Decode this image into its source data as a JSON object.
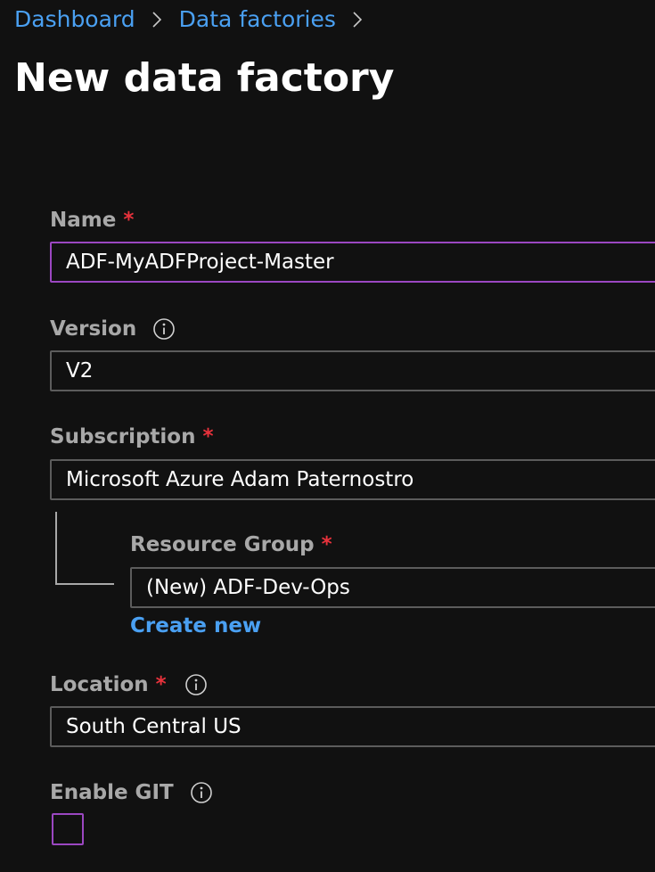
{
  "breadcrumb": {
    "items": [
      "Dashboard",
      "Data factories"
    ]
  },
  "page": {
    "title": "New data factory"
  },
  "form": {
    "name": {
      "label": "Name",
      "required_mark": "*",
      "value": "ADF-MyADFProject-Master"
    },
    "version": {
      "label": "Version",
      "value": "V2",
      "info_icon": "info-icon"
    },
    "subscription": {
      "label": "Subscription",
      "required_mark": "*",
      "value": "Microsoft Azure Adam Paternostro"
    },
    "resource_group": {
      "label": "Resource Group",
      "required_mark": "*",
      "value": "(New) ADF-Dev-Ops",
      "create_new_link": "Create new"
    },
    "location": {
      "label": "Location",
      "required_mark": "*",
      "value": "South Central US",
      "info_icon": "info-icon"
    },
    "enable_git": {
      "label": "Enable GIT",
      "checked": false,
      "info_icon": "info-icon"
    }
  },
  "colors": {
    "background": "#111111",
    "link": "#4aa0f2",
    "required": "#e8323c",
    "focus_border": "#9b47c1",
    "input_border": "#5c5c5c",
    "label": "#a8a8a8"
  }
}
